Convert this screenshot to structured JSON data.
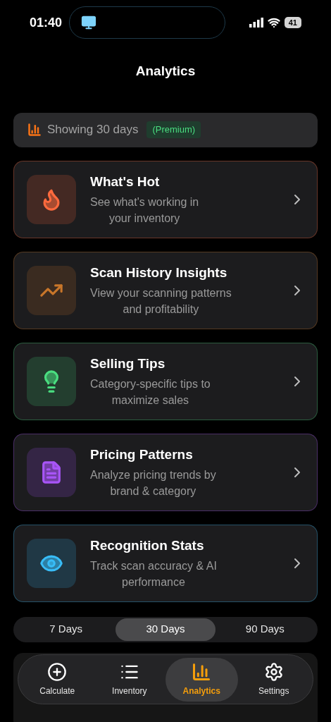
{
  "status_bar": {
    "time": "01:40",
    "battery": "41"
  },
  "title": "Analytics",
  "banner": {
    "text": "Showing 30 days",
    "badge": "(Premium)"
  },
  "cards": [
    {
      "kind": "flame",
      "title": "What's Hot",
      "subtitle": "See what's working in\nyour inventory",
      "color": "#ff6a3d"
    },
    {
      "kind": "trend",
      "title": "Scan History Insights",
      "subtitle": "View your scanning patterns\nand profitability",
      "color": "#c8762a"
    },
    {
      "kind": "bulb",
      "title": "Selling Tips",
      "subtitle": "Category-specific tips to\nmaximize sales",
      "color": "#4ade80"
    },
    {
      "kind": "doc",
      "title": "Pricing Patterns",
      "subtitle": "Analyze pricing trends by\nbrand & category",
      "color": "#a855f7"
    },
    {
      "kind": "eye",
      "title": "Recognition Stats",
      "subtitle": "Track scan accuracy & AI\nperformance",
      "color": "#38bdf8"
    }
  ],
  "ranges": [
    {
      "label": "7 Days",
      "selected": false
    },
    {
      "label": "30 Days",
      "selected": true
    },
    {
      "label": "90 Days",
      "selected": false
    }
  ],
  "tabs": [
    {
      "kind": "add",
      "label": "Calculate",
      "selected": false
    },
    {
      "kind": "list",
      "label": "Inventory",
      "selected": false
    },
    {
      "kind": "chart",
      "label": "Analytics",
      "selected": true
    },
    {
      "kind": "gear",
      "label": "Settings",
      "selected": false
    }
  ]
}
